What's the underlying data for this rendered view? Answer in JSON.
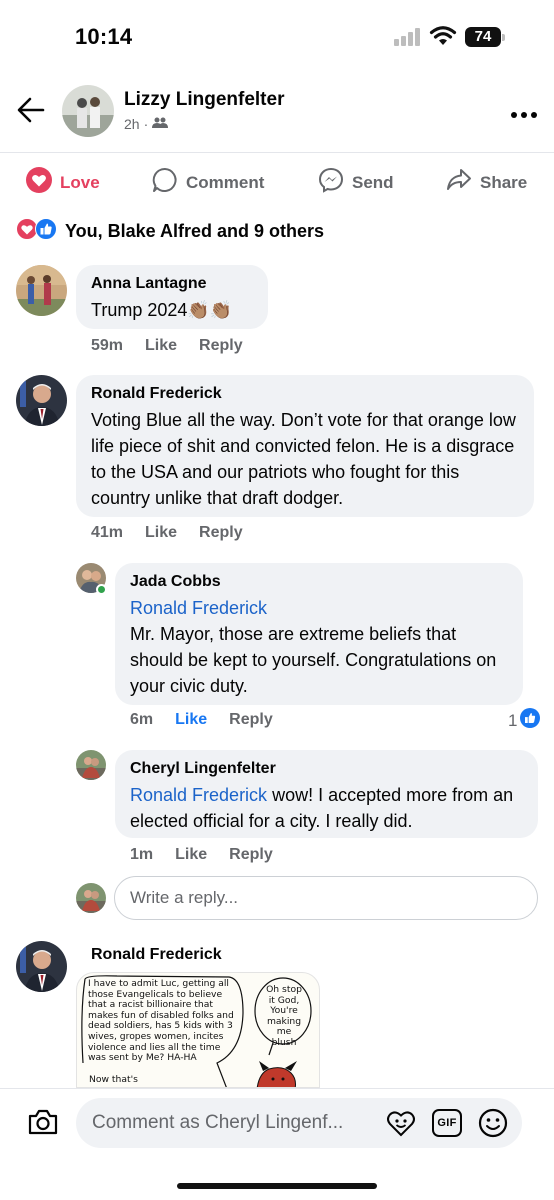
{
  "status": {
    "time": "10:14",
    "battery": "74"
  },
  "post": {
    "author": "Lizzy Lingenfelter",
    "time": "2h",
    "audience_icon": "friends-icon"
  },
  "actions": {
    "love": "Love",
    "comment": "Comment",
    "send": "Send",
    "share": "Share"
  },
  "reactions": {
    "summary": "You, Blake Alfred and 9 others"
  },
  "comments": [
    {
      "author": "Anna Lantagne",
      "text": "Trump 2024",
      "emoji": "👏🏽👏🏽",
      "time": "59m",
      "like": "Like",
      "reply": "Reply"
    },
    {
      "author": "Ronald Frederick",
      "text": "Voting Blue all the way.  Don’t vote for that orange low life piece of shit and convicted felon. He is a disgrace to the USA and our patriots who fought for this country unlike that draft dodger.",
      "time": "41m",
      "like": "Like",
      "reply": "Reply"
    }
  ],
  "replies": [
    {
      "author": "Jada Cobbs",
      "mention": "Ronald Frederick",
      "text": "Mr. Mayor, those are extreme beliefs that should be kept to yourself. Congratulations on your civic duty.",
      "time": "6m",
      "like": "Like",
      "reply": "Reply",
      "like_count": "1"
    },
    {
      "author": "Cheryl Lingenfelter",
      "mention": "Ronald Frederick",
      "text": " wow! I accepted more from an elected official for a city. I really did.",
      "time": "1m",
      "like": "Like",
      "reply": "Reply"
    }
  ],
  "reply_input": {
    "placeholder": "Write a reply..."
  },
  "last_comment": {
    "author": "Ronald Frederick",
    "cartoon": {
      "left_bubble": "I have to admit Luc, getting all those Evangelicals to believe that a racist billionaire that makes fun of disabled folks and dead soldiers, has 5 kids with 3 wives, gropes women, incites violence and lies all the time was sent by Me? HA-HA",
      "bottom_text": "Now that's",
      "right_bubble": "Oh stop it God, You're making me blush"
    }
  },
  "bottom": {
    "comment_placeholder": "Comment as Cheryl Lingenf...",
    "gif": "GIF"
  },
  "colors": {
    "love": "#e4405f",
    "link": "#1b63c9",
    "like_blue": "#1877f2",
    "bubble": "#f0f2f5"
  }
}
